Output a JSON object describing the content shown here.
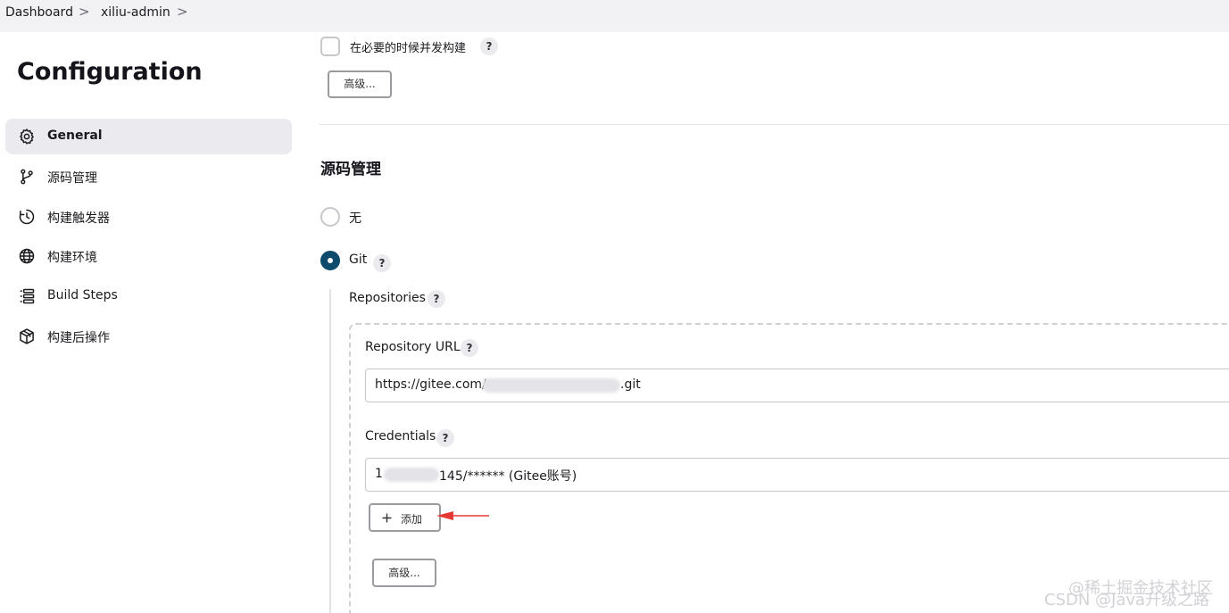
{
  "breadcrumb": {
    "items": [
      "Dashboard",
      "xiliu-admin"
    ],
    "separator": ">"
  },
  "page": {
    "title": "Configuration"
  },
  "sidebar": {
    "items": [
      {
        "label": "General",
        "icon": "gear-icon",
        "active": true
      },
      {
        "label": "源码管理",
        "icon": "branch-icon",
        "active": false
      },
      {
        "label": "构建触发器",
        "icon": "clock-icon",
        "active": false
      },
      {
        "label": "构建环境",
        "icon": "globe-icon",
        "active": false
      },
      {
        "label": "Build Steps",
        "icon": "list-icon",
        "active": false
      },
      {
        "label": "构建后操作",
        "icon": "package-icon",
        "active": false
      }
    ]
  },
  "general": {
    "concurrent_build_label": "在必要的时候并发构建",
    "concurrent_build_checked": false,
    "advanced_label": "高级..."
  },
  "scm": {
    "title": "源码管理",
    "options": [
      {
        "label": "无",
        "selected": false
      },
      {
        "label": "Git",
        "selected": true
      }
    ],
    "repositories_label": "Repositories",
    "repository_url_label": "Repository URL",
    "repository_url_value": "https://gitee.com/",
    "repository_url_suffix": ".git",
    "credentials_label": "Credentials",
    "credentials_value_prefix": "1",
    "credentials_value": "145/****** (Gitee账号)",
    "add_button_label": "添加",
    "advanced_label": "高级..."
  },
  "help_symbol": "?",
  "watermark": {
    "line1": "@稀土掘金技术社区",
    "line2": "CSDN @Java升级之路"
  },
  "colors": {
    "accent": "#0e4a6b",
    "arrow": "#e53935",
    "breadcrumb_bg": "#f2f2f5",
    "active_nav_bg": "#ebebef"
  }
}
